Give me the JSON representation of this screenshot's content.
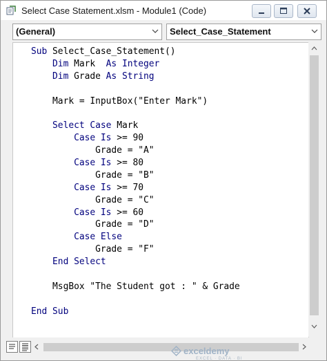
{
  "window": {
    "title": "Select Case Statement.xlsm - Module1 (Code)",
    "icon": "vba-module-icon",
    "buttons": [
      "minimize-icon",
      "maximize-icon",
      "close-icon"
    ]
  },
  "dropdowns": {
    "object": "(General)",
    "procedure": "Select_Case_Statement"
  },
  "code": {
    "keyword_color": "#00007d",
    "lines": [
      [
        {
          "t": "Sub ",
          "k": true
        },
        {
          "t": "Select_Case_Statement()"
        }
      ],
      [
        {
          "t": "    "
        },
        {
          "t": "Dim ",
          "k": true
        },
        {
          "t": "Mark  "
        },
        {
          "t": "As Integer",
          "k": true
        }
      ],
      [
        {
          "t": "    "
        },
        {
          "t": "Dim ",
          "k": true
        },
        {
          "t": "Grade "
        },
        {
          "t": "As String",
          "k": true
        }
      ],
      [],
      [
        {
          "t": "    Mark = InputBox(\"Enter Mark\")"
        }
      ],
      [],
      [
        {
          "t": "    "
        },
        {
          "t": "Select Case ",
          "k": true
        },
        {
          "t": "Mark"
        }
      ],
      [
        {
          "t": "        "
        },
        {
          "t": "Case Is ",
          "k": true
        },
        {
          "t": ">= 90"
        }
      ],
      [
        {
          "t": "            Grade = \"A\""
        }
      ],
      [
        {
          "t": "        "
        },
        {
          "t": "Case Is ",
          "k": true
        },
        {
          "t": ">= 80"
        }
      ],
      [
        {
          "t": "            Grade = \"B\""
        }
      ],
      [
        {
          "t": "        "
        },
        {
          "t": "Case Is ",
          "k": true
        },
        {
          "t": ">= 70"
        }
      ],
      [
        {
          "t": "            Grade = \"C\""
        }
      ],
      [
        {
          "t": "        "
        },
        {
          "t": "Case Is ",
          "k": true
        },
        {
          "t": ">= 60"
        }
      ],
      [
        {
          "t": "            Grade = \"D\""
        }
      ],
      [
        {
          "t": "        "
        },
        {
          "t": "Case Else",
          "k": true
        }
      ],
      [
        {
          "t": "            Grade = \"F\""
        }
      ],
      [
        {
          "t": "    "
        },
        {
          "t": "End Select",
          "k": true
        }
      ],
      [],
      [
        {
          "t": "    MsgBox \"The Student got : \" & Grade"
        }
      ],
      [],
      [
        {
          "t": "End Sub",
          "k": true
        }
      ]
    ]
  },
  "bottom": {
    "watermark": "exceldemy",
    "watermark_tagline": "EXCEL · DATA · BI"
  }
}
